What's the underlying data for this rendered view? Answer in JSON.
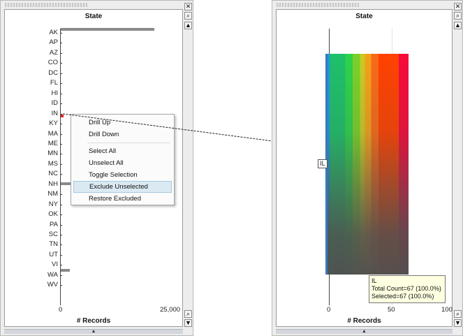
{
  "left_panel": {
    "title": "State",
    "axis_title": "# Records",
    "x_ticks": [
      "0",
      "25,000"
    ],
    "states": [
      "AK",
      "AP",
      "AZ",
      "CO",
      "DC",
      "FL",
      "HI",
      "ID",
      "IN",
      "KY",
      "MA",
      "ME",
      "MN",
      "MS",
      "NC",
      "NH",
      "NM",
      "NY",
      "OK",
      "PA",
      "SC",
      "TN",
      "UT",
      "VI",
      "WA",
      "WV"
    ],
    "close_icon": "close-icon",
    "zoom_icon": "zoom-icon"
  },
  "context_menu": {
    "items": [
      {
        "label": "Drill Up"
      },
      {
        "label": "Drill Down"
      },
      {
        "label": "Select All"
      },
      {
        "label": "Unselect All"
      },
      {
        "label": "Toggle Selection"
      },
      {
        "label": "Exclude Unselected"
      },
      {
        "label": "Restore Excluded"
      }
    ],
    "highlighted": "Exclude Unselected"
  },
  "right_panel": {
    "title": "State",
    "axis_title": "# Records",
    "x_ticks": [
      "0",
      "50",
      "100"
    ],
    "bar_label": "IL",
    "tooltip": {
      "line1": "IL",
      "line2": "Total Count=67 (100.0%)",
      "line3": "Selected=67 (100.0%)"
    },
    "bar_value": 67,
    "gradient_colors": [
      "#1e9bd6",
      "#1ec06a",
      "#2ed34a",
      "#7bd12a",
      "#c9cc22",
      "#f2a21b",
      "#fb6a16",
      "#ff4200",
      "#f80a3a"
    ]
  },
  "colors": {
    "panel_bg": "#ededed",
    "bar_gray": "#8a8a8a",
    "highlight": "#dbe9f3",
    "tooltip_bg": "#ffffe1"
  }
}
